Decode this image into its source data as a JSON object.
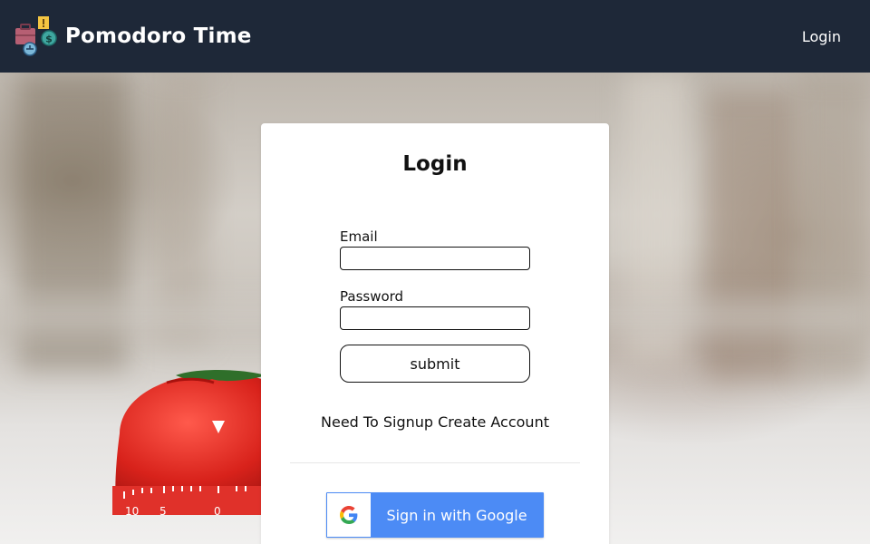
{
  "header": {
    "app_title": "Pomodoro Time",
    "nav_login": "Login",
    "logo_icon": "pomodoro-logo-icon",
    "background_color": "#1e2838"
  },
  "login_card": {
    "title": "Login",
    "email_label": "Email",
    "email_value": "",
    "password_label": "Password",
    "password_value": "",
    "submit_label": "submit",
    "signup_text": "Need To Signup Create Account",
    "google_button_label": "Sign in with Google",
    "google_icon": "google-g-icon",
    "google_button_color": "#4c8bf5"
  },
  "background": {
    "image_subject": "tomato-kitchen-timer"
  }
}
